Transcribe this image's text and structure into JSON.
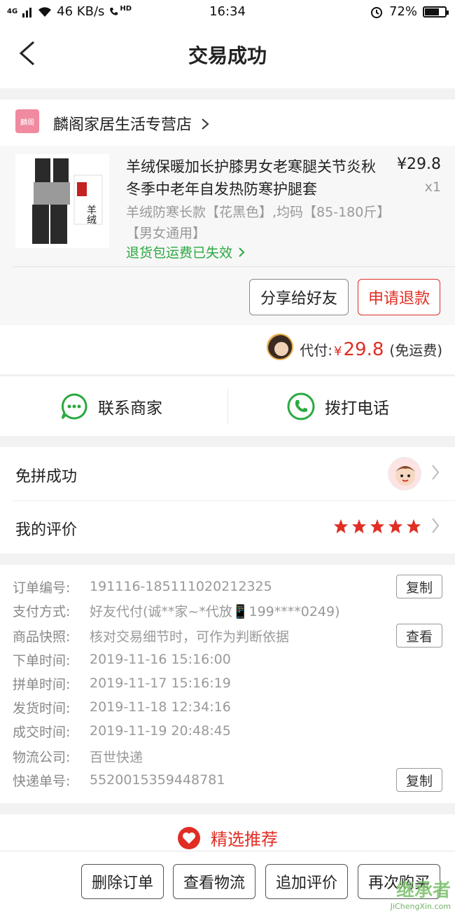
{
  "status_bar": {
    "network": "4G",
    "speed": "46 KB/s",
    "hd": "HD",
    "time": "16:34",
    "battery": "72%",
    "battery_level": 0.72
  },
  "header": {
    "title": "交易成功"
  },
  "shop": {
    "logo_text": "麟阁",
    "name": "麟阁家居生活专营店"
  },
  "product": {
    "title": "羊绒保暖加长护膝男女老寒腿关节炎秋冬季中老年自发热防寒护腿套",
    "price": "¥29.8",
    "qty": "x1",
    "spec": "羊绒防寒长款【花黑色】,均码【85-180斤】【男女通用】",
    "return_note": "退货包运费已失效",
    "image_text": "羊绒",
    "share_label": "分享给好友",
    "refund_label": "申请退款"
  },
  "payment": {
    "label": "代付:",
    "currency": "¥",
    "amount": "29.8",
    "shipping": "(免运费)"
  },
  "contact": {
    "merchant_label": "联系商家",
    "call_label": "拨打电话"
  },
  "rows": {
    "group_label": "免拼成功",
    "review_label": "我的评价",
    "stars": 5
  },
  "order": {
    "lines": [
      {
        "key": "订单编号:",
        "value": "191116-185111020212325",
        "action": "复制"
      },
      {
        "key": "支付方式:",
        "value": "好友代付(诚**家~*代放📱199****0249)",
        "action": ""
      },
      {
        "key": "商品快照:",
        "value": "核对交易细节时，可作为判断依据",
        "action": "查看"
      },
      {
        "key": "下单时间:",
        "value": "2019-11-16 15:16:00",
        "action": ""
      },
      {
        "key": "拼单时间:",
        "value": "2019-11-17 15:16:19",
        "action": ""
      },
      {
        "key": "发货时间:",
        "value": "2019-11-18 12:34:16",
        "action": ""
      },
      {
        "key": "成交时间:",
        "value": "2019-11-19 20:48:45",
        "action": ""
      },
      {
        "key": "物流公司:",
        "value": "百世快递",
        "action": ""
      },
      {
        "key": "快递单号:",
        "value": "5520015359448781",
        "action": "复制"
      }
    ]
  },
  "recommend": {
    "label": "精选推荐"
  },
  "bottom_bar": {
    "delete_label": "删除订单",
    "logistics_label": "查看物流",
    "add_review_label": "追加评价",
    "rebuy_label": "再次购买"
  },
  "watermark": {
    "line1": "继承者",
    "line2": "JiChengXin.com"
  },
  "colors": {
    "accent": "#e02e24",
    "green": "#2aa940",
    "star": "#e02e24"
  }
}
